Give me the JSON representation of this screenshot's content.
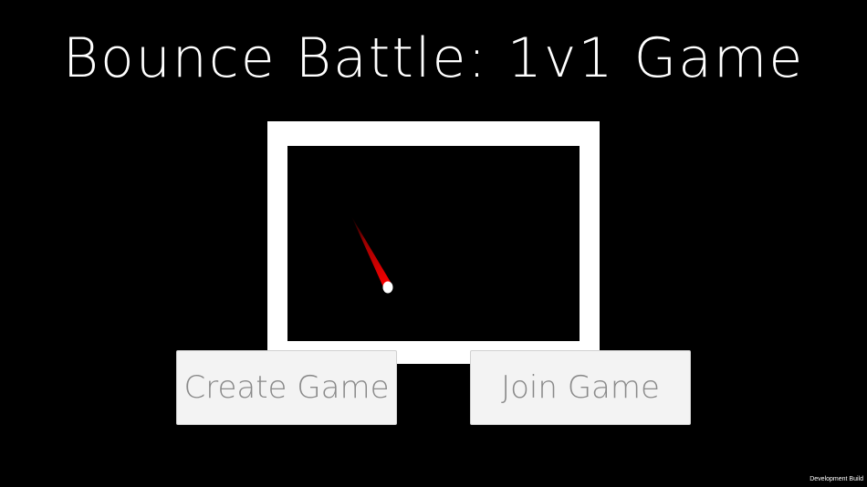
{
  "game": {
    "title": "Bounce Battle: 1v1 Game"
  },
  "menu": {
    "create_label": "Create Game",
    "join_label": "Join Game"
  },
  "footer": {
    "build_label": "Development Build"
  },
  "colors": {
    "background": "#000000",
    "arena_border": "#ffffff",
    "ball": "#ffffff",
    "ball_trail": "#ff0000",
    "button_bg": "#f3f3f3",
    "button_text": "#8a8a8a"
  }
}
